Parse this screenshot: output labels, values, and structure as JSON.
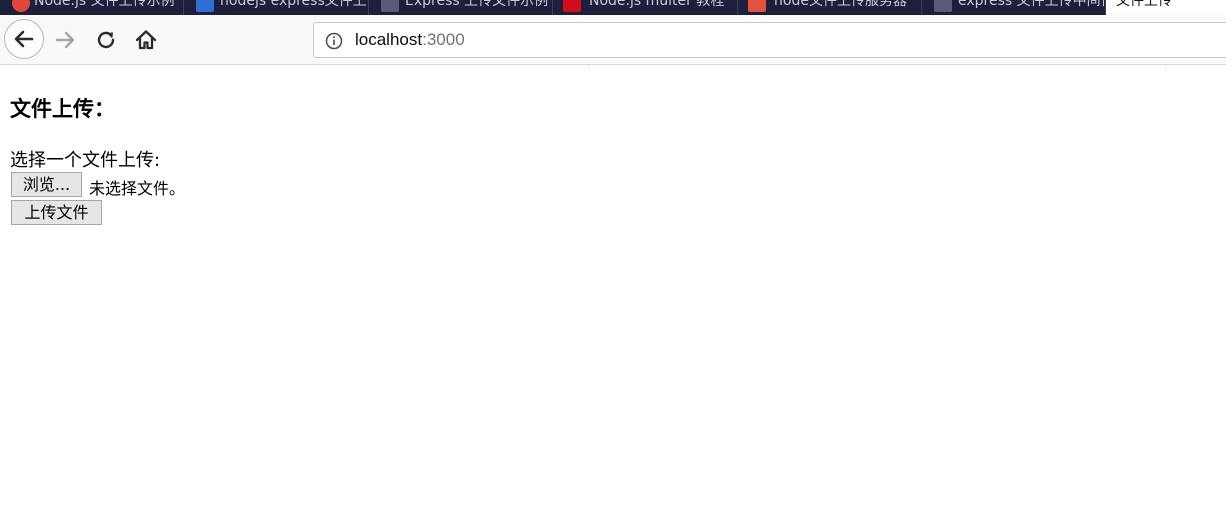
{
  "browser": {
    "tabs": [
      {
        "title": "Node.js 文件上传示例",
        "favicon_color": "#e0483b"
      },
      {
        "title": "nodejs express文件上传",
        "favicon_color": "#2f6fd1"
      },
      {
        "title": "Express 上传文件示例",
        "favicon_color": "#5a5b78"
      },
      {
        "title": "Node.js multer 教程",
        "favicon_color": "#d10c1c"
      },
      {
        "title": "node文件上传服务器",
        "favicon_color": "#e2533b"
      },
      {
        "title": "express 文件上传中间件",
        "favicon_color": "#5a5b78"
      },
      {
        "title": "文件上传",
        "favicon_color": "#ffffff",
        "active": true
      }
    ],
    "url": {
      "host": "localhost",
      "port": ":3000"
    },
    "icons": {
      "back": "back-arrow-icon",
      "forward": "forward-arrow-icon",
      "reload": "reload-icon",
      "home": "home-icon",
      "info": "info-icon"
    }
  },
  "page": {
    "heading": "文件上传：",
    "label": "选择一个文件上传:",
    "browse_button": "浏览...",
    "no_file_text": "未选择文件。",
    "upload_button": "上传文件"
  }
}
